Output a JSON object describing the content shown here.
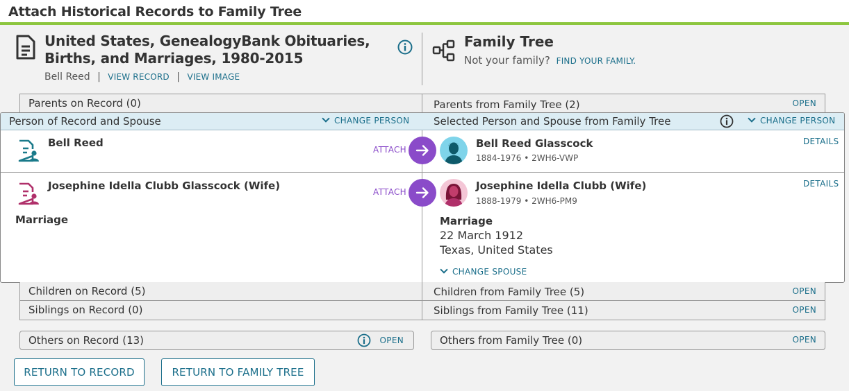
{
  "page_title": "Attach Historical Records to Family Tree",
  "record": {
    "title": "United States, GenealogyBank Obituaries, Births, and Marriages, 1980-2015",
    "person": "Bell Reed",
    "separator": "|",
    "view_record": "VIEW RECORD",
    "view_image": "VIEW IMAGE"
  },
  "tree": {
    "title": "Family Tree",
    "not_family": "Not your family?",
    "find_family": "FIND YOUR FAMILY."
  },
  "sections": {
    "parents_record": "Parents on Record (0)",
    "parents_tree": "Parents from Family Tree (2)",
    "children_record": "Children on Record (5)",
    "children_tree": "Children from Family Tree (5)",
    "siblings_record": "Siblings on Record (0)",
    "siblings_tree": "Siblings from Family Tree (11)",
    "others_record": "Others on Record (13)",
    "others_tree": "Others from Family Tree (0)",
    "open": "OPEN"
  },
  "card": {
    "left_header": "Person of Record and Spouse",
    "right_header": "Selected Person and Spouse from Family Tree",
    "change_person": "CHANGE PERSON",
    "attach": "ATTACH",
    "details": "DETAILS",
    "person1_record": "Bell Reed",
    "person1_tree": "Bell Reed Glasscock",
    "person1_meta": "1884-1976 • 2WH6-VWP",
    "person2_record": "Josephine Idella Clubb Glasscock (Wife)",
    "person2_tree": "Josephine Idella Clubb (Wife)",
    "person2_meta": "1888-1979 • 2WH6-PM9",
    "marriage_left": "Marriage",
    "marriage_right": "Marriage",
    "marriage_date": "22 March 1912",
    "marriage_place": "Texas, United States",
    "change_spouse": "CHANGE SPOUSE"
  },
  "buttons": {
    "return_record": "RETURN TO RECORD",
    "return_tree": "RETURN TO FAMILY TREE"
  },
  "colors": {
    "accent_green": "#8dc63f",
    "link_teal": "#1a6e8a",
    "attach_purple": "#8a4bc9",
    "header_blue": "#dcedf4",
    "male_icon": "#1a7a8a",
    "female_icon": "#b0306a"
  }
}
